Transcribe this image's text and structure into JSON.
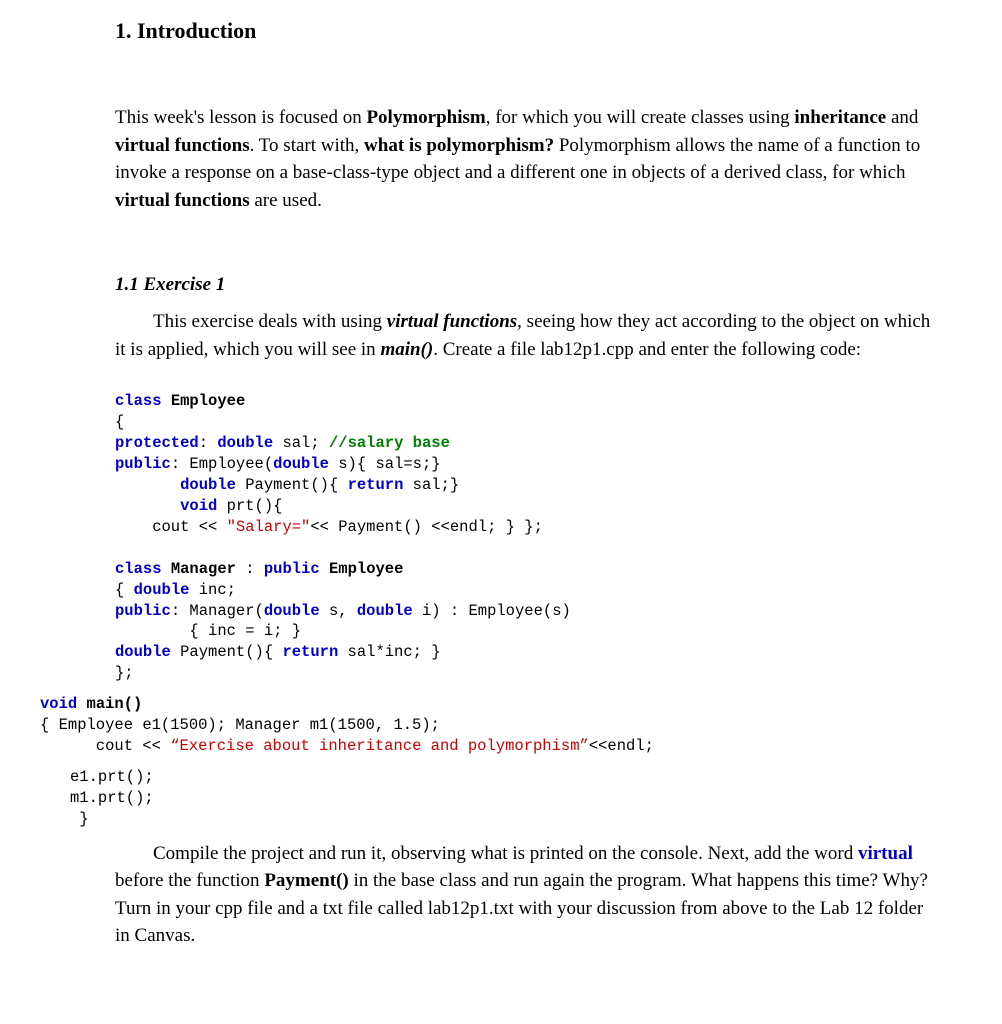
{
  "h1": "1. Introduction",
  "para1_pre": "This week's lesson is focused on ",
  "para1_b1": "Polymorphism",
  "para1_mid1": ", for which you will create classes using ",
  "para1_b2": "inheritance",
  "para1_mid2": " and ",
  "para1_b3": "virtual functions",
  "para1_mid3": ". To start with, ",
  "para1_b4": "what is polymorphism?",
  "para1_mid4": " Polymorphism allows the name of a function to invoke a response on a base-class-type object and a different one in objects of a derived class, for which ",
  "para1_b5": "virtual functions",
  "para1_end": " are used.",
  "h2": "1.1 Exercise 1",
  "para2_pre": "This exercise deals with using ",
  "para2_bi1": "virtual functions",
  "para2_mid1": ", seeing how they act according to the object on which it is applied, which you will see in ",
  "para2_bi2": "main()",
  "para2_end": ". Create a file lab12p1.cpp and enter the following code:",
  "code": {
    "k_class": "class",
    "Employee": "Employee",
    "brace_o": "{",
    "k_protected": "protected",
    "colon": ":",
    "sp": " ",
    "k_double": "double",
    "sal_decl": " sal; ",
    "comment1": "//salary base",
    "k_public": "public",
    "emp_ctor1": ": Employee(",
    "emp_ctor2": " s){ sal=s;}",
    "pay_sig1": " Payment(){ ",
    "k_return": "return",
    "pay_ret": " sal;}",
    "k_void": "void",
    "prt_sig": " prt(){",
    "cout_pre": "    cout << ",
    "salary_str": "\"Salary=\"",
    "cout_post": "<< Payment() <<endl; } };",
    "Manager": "Manager",
    "mgr_head2": " : ",
    "inc_decl": "{ ",
    "inc_decl2": " inc;",
    "mgr_ctor1": ": Manager(",
    "mgr_ctor2": " s, ",
    "mgr_ctor3": " i) : Employee(s)",
    "mgr_body": "        { inc = i; }",
    "mgr_pay1": " Payment(){ ",
    "mgr_pay2": " sal*inc; }",
    "brace_c": "};",
    "main_sig": " main()",
    "main_body1": "{ Employee e1(1500); Manager m1(1500, 1.5);",
    "cout2_pre": "      cout << ",
    "ex_str": "“Exercise about inheritance and polymorphism”",
    "cout2_post": "<<endl;",
    "e1prt": "e1.prt();",
    "m1prt": "m1.prt();",
    "end_brace": " }"
  },
  "para3_pre": "Compile the project and run it, observing what is printed on the console. Next, add the word ",
  "para3_virtual": "virtual",
  "para3_mid1": " before the function ",
  "para3_b1": "Payment()",
  "para3_end": " in the base class and run again the program. What happens this time? Why? Turn in your cpp file and a txt file called lab12p1.txt with your discussion from above to the Lab 12 folder in Canvas."
}
